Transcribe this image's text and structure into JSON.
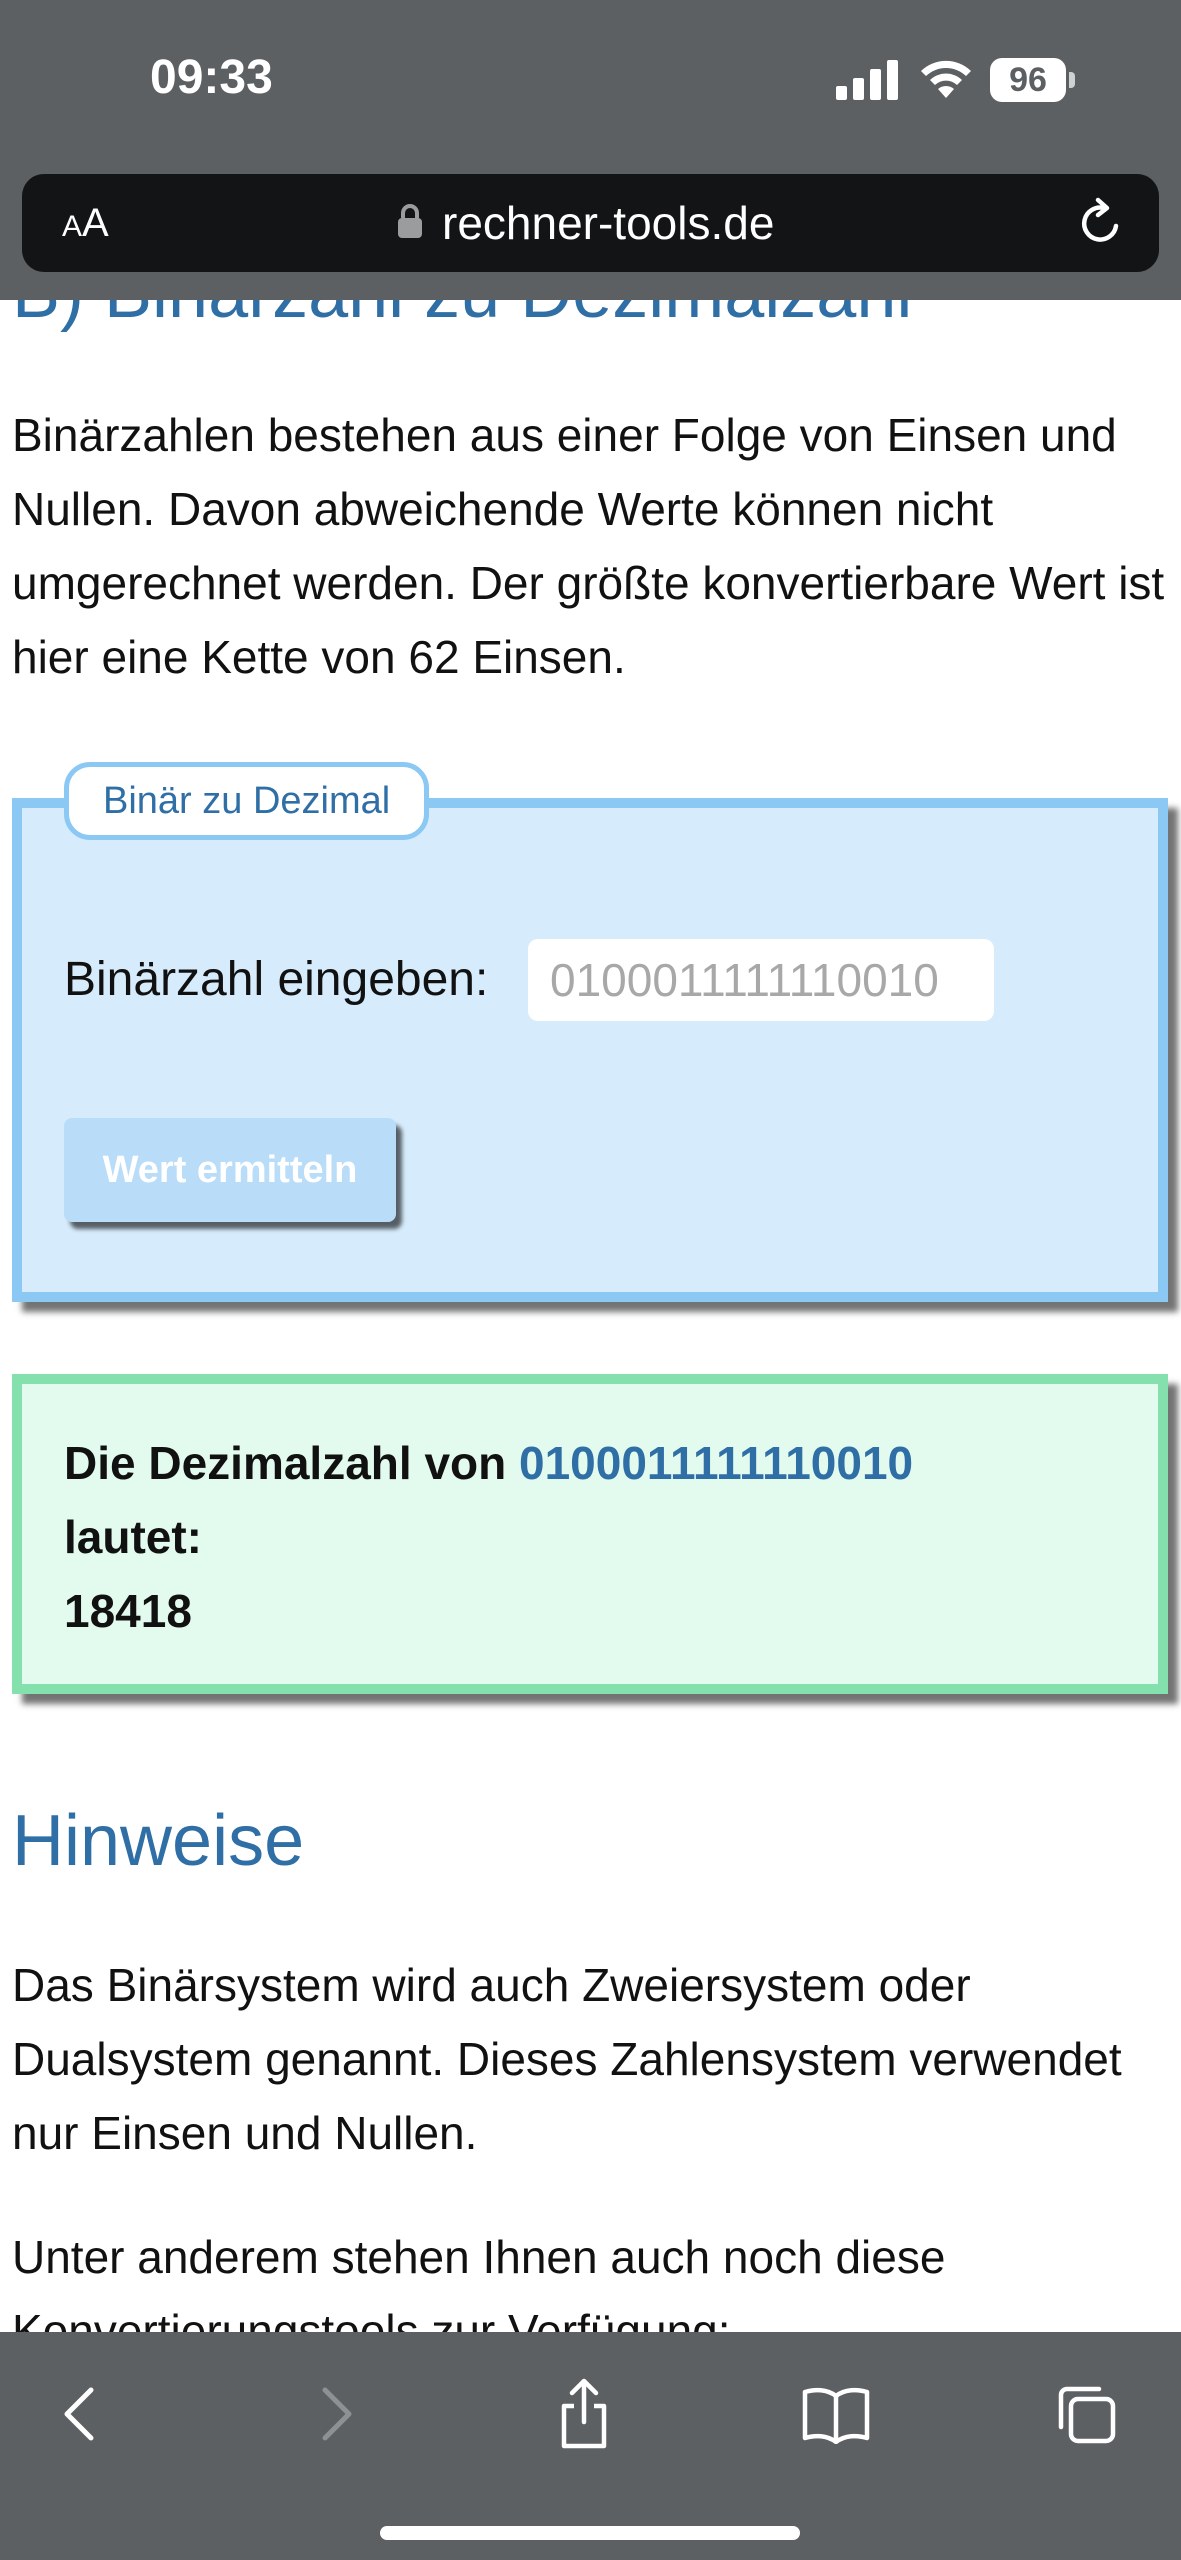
{
  "status_bar": {
    "time": "09:33",
    "battery": "96",
    "icons": [
      "signal-icon",
      "wifi-icon",
      "battery-icon"
    ]
  },
  "browser": {
    "text_size_label_small": "A",
    "text_size_label_big": "A",
    "url": "rechner-tools.de",
    "icons": [
      "lock-icon",
      "reload-icon"
    ],
    "toolbar_icons": [
      "back-icon",
      "forward-icon",
      "share-icon",
      "bookmarks-icon",
      "tabs-icon"
    ]
  },
  "page": {
    "section_heading": "B) Binärzahl zu Dezimalzahl",
    "intro": "Binärzahlen bestehen aus einer Folge von Einsen und Nullen. Davon abweichende Werte können nicht umgerechnet werden. Der größte konvertierbare Wert ist hier eine Kette von 62 Einsen.",
    "converter": {
      "legend": "Binär zu Dezimal",
      "input_label": "Binärzahl eingeben:",
      "input_placeholder": "0100011111110010",
      "button_label": "Wert ermitteln"
    },
    "result": {
      "prefix": "Die Dezimalzahl von",
      "binary": "0100011111110010",
      "suffix": "lautet:",
      "value": "18418"
    },
    "hinweise_heading": "Hinweise",
    "hinweise_text": "Das Binärsystem wird auch Zweiersystem oder Dualsystem genannt. Dieses Zahlensystem verwendet nur Einsen und Nullen.",
    "tools_text": "Unter anderem stehen Ihnen auch noch diese Konvertierungstools zur Verfügung:"
  },
  "colors": {
    "heading_blue": "#2f6fa6",
    "form_bg": "#d6ecfc",
    "form_border": "#8cc8f4",
    "result_bg": "#e2fbee",
    "result_border": "#84e1ae",
    "chrome_gray": "#5c6063"
  }
}
